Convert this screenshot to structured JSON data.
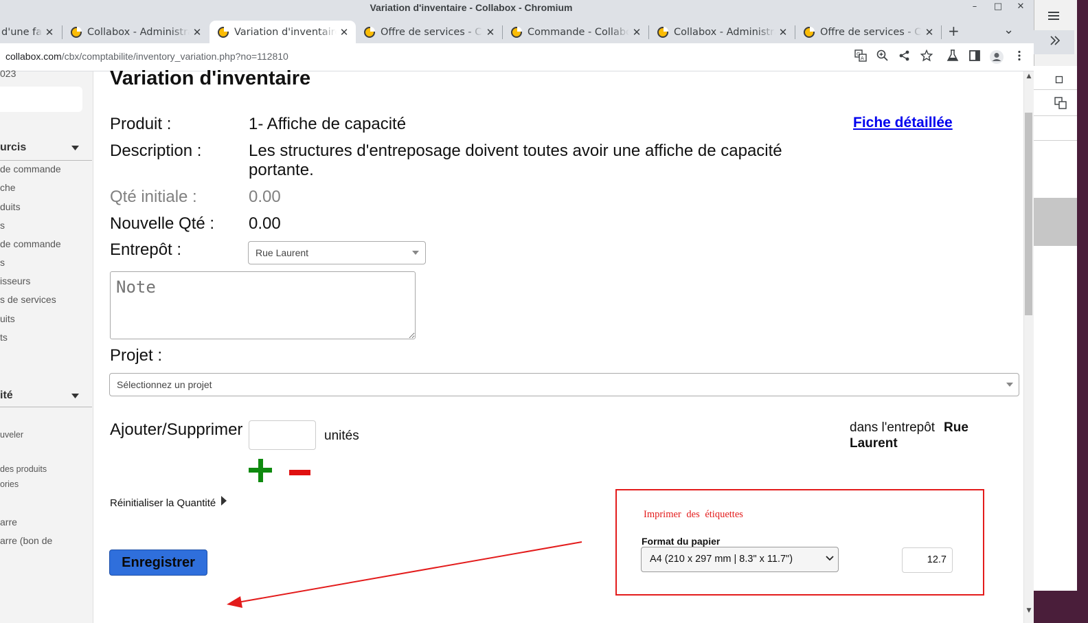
{
  "window": {
    "title": "Variation d'inventaire - Collabox - Chromium",
    "controls": {
      "minimize": "–",
      "maximize": "□",
      "close": "✕"
    }
  },
  "tabs": [
    {
      "label": "d'une fa",
      "active": false
    },
    {
      "label": "Collabox - Administra",
      "active": false
    },
    {
      "label": "Variation d'inventaire",
      "active": true
    },
    {
      "label": "Offre de services - Col",
      "active": false
    },
    {
      "label": "Commande - Collabox",
      "active": false
    },
    {
      "label": "Collabox - Administra",
      "active": false
    },
    {
      "label": "Offre de services - Col",
      "active": false
    }
  ],
  "tabstrip": {
    "new_tab": "+",
    "tab_search": "⌄",
    "close_glyph": "✕"
  },
  "address": {
    "host": "collabox.com",
    "path": "/cbx/comptabilite/inventory_variation.php?no=112810"
  },
  "toolbar_icons": [
    "translate-icon",
    "zoom-icon",
    "share-icon",
    "bookmark-star-icon",
    "labs-flask-icon",
    "side-panel-icon",
    "profile-icon",
    "kebab-menu-icon"
  ],
  "sidebar": {
    "year_fragment": "023",
    "sections": [
      {
        "title": "urcis",
        "items": [
          "de commande",
          "che",
          "duits",
          "s",
          "de commande",
          "s",
          "isseurs",
          "s de services",
          "uits",
          "ts"
        ]
      },
      {
        "title": "ité",
        "items": [
          "uveler",
          "des produits",
          "ories",
          "arre",
          "arre (bon de"
        ]
      }
    ]
  },
  "page": {
    "title": "Variation d'inventaire",
    "detail_link": "Fiche détaillée",
    "fields": {
      "product_label": "Produit :",
      "product_value": "1- Affiche de capacité",
      "description_label": "Description :",
      "description_line1": "Les structures d'entreposage doivent toutes avoir une affiche de capacité",
      "description_line2": "portante.",
      "initial_qty_label": "Qté initiale :",
      "initial_qty_value": "0.00",
      "new_qty_label": "Nouvelle Qté :",
      "new_qty_value": "0.00",
      "warehouse_label": "Entrepôt :",
      "warehouse_value": "Rue Laurent",
      "note_placeholder": "Note",
      "project_label": "Projet :",
      "project_placeholder": "Sélectionnez un projet"
    },
    "adjust": {
      "label": "Ajouter/Supprimer",
      "qty_value": "",
      "units_label": "unités",
      "plus": "+",
      "minus": "−",
      "warehouse_prefix": "dans l'entrepôt",
      "warehouse_name_1": "Rue",
      "warehouse_name_2": "Laurent"
    },
    "reset_label": "Réinitialiser la Quantité",
    "save_button": "Enregistrer"
  },
  "annotation": {
    "color": "#e31b1b",
    "print_title": "Imprimer des étiquettes",
    "paper_label": "Format du papier",
    "paper_value": "A4 (210 x 297 mm | 8.3\" x 11.7\")",
    "size_value": "12.7"
  },
  "colors": {
    "accent_button": "#2f6fdc",
    "plus": "#0f8a0f",
    "minus": "#e01010",
    "link": "#0000ee"
  }
}
